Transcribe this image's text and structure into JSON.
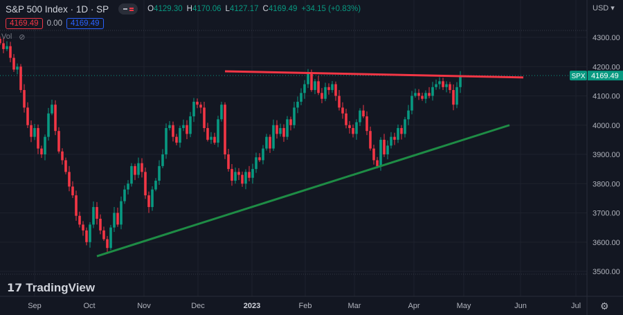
{
  "header": {
    "title": "S&P 500 Index · 1D · SP",
    "o_label": "O",
    "o": "4129.30",
    "h_label": "H",
    "h": "4170.06",
    "l_label": "L",
    "l": "4127.17",
    "c_label": "C",
    "c": "4169.49",
    "change": "+34.15 (+0.83%)",
    "bid": "4169.49",
    "spread": "0.00",
    "ask": "4169.49",
    "vol_label": "Vol",
    "currency": "USD"
  },
  "logo": "TradingView",
  "price_label": {
    "symbol": "SPX",
    "value": "4169.49"
  },
  "colors": {
    "up": "#089981",
    "down": "#f23645",
    "resistance": "#f23645",
    "support": "#1e8c45",
    "bg": "#131722"
  },
  "chart_data": {
    "type": "candlestick",
    "title": "S&P 500 Index · 1D · SP",
    "ylim": [
      3480,
      4340
    ],
    "yticks": [
      3500,
      3600,
      3700,
      3800,
      3900,
      4000,
      4100,
      4200,
      4300
    ],
    "ytick_labels": [
      "3500.00",
      "3600.00",
      "3700.00",
      "3800.00",
      "3900.00",
      "4000.00",
      "4100.00",
      "4200.00",
      "4300.00"
    ],
    "xtick_labels": [
      "Sep",
      "Oct",
      "Nov",
      "Dec",
      "2023",
      "Feb",
      "Mar",
      "Apr",
      "May",
      "Jun",
      "Jul"
    ],
    "closes": [
      4280,
      4260,
      4270,
      4230,
      4190,
      4200,
      4120,
      4060,
      4000,
      3960,
      3990,
      3920,
      3900,
      3960,
      4040,
      4070,
      3980,
      3910,
      3880,
      3840,
      3790,
      3760,
      3690,
      3660,
      3640,
      3600,
      3660,
      3720,
      3680,
      3640,
      3610,
      3580,
      3650,
      3700,
      3660,
      3740,
      3780,
      3800,
      3860,
      3830,
      3870,
      3840,
      3760,
      3720,
      3780,
      3810,
      3860,
      3900,
      3990,
      4000,
      3960,
      3940,
      3990,
      4000,
      3970,
      4030,
      4080,
      4070,
      4060,
      3990,
      3950,
      3960,
      3940,
      4020,
      4070,
      3900,
      3850,
      3810,
      3840,
      3830,
      3800,
      3840,
      3820,
      3850,
      3890,
      3880,
      3920,
      3960,
      3920,
      4000,
      3970,
      3990,
      3960,
      4020,
      4000,
      4060,
      4080,
      4110,
      4140,
      4180,
      4120,
      4150,
      4110,
      4090,
      4130,
      4120,
      4140,
      4100,
      4060,
      4040,
      4000,
      3990,
      3970,
      4010,
      4050,
      4030,
      3980,
      3920,
      3880,
      3860,
      3950,
      3900,
      3930,
      3960,
      3950,
      3990,
      3970,
      4020,
      4050,
      4100,
      4110,
      4100,
      4090,
      4110,
      4100,
      4130,
      4140,
      4150,
      4130,
      4140,
      4120,
      4070,
      4130,
      4169.49
    ],
    "trendlines": [
      {
        "name": "resistance",
        "start_price": 4184,
        "end_price": 4163
      },
      {
        "name": "support",
        "start_price": 3552,
        "end_price": 4000
      }
    ],
    "last_price": 4169.49
  }
}
